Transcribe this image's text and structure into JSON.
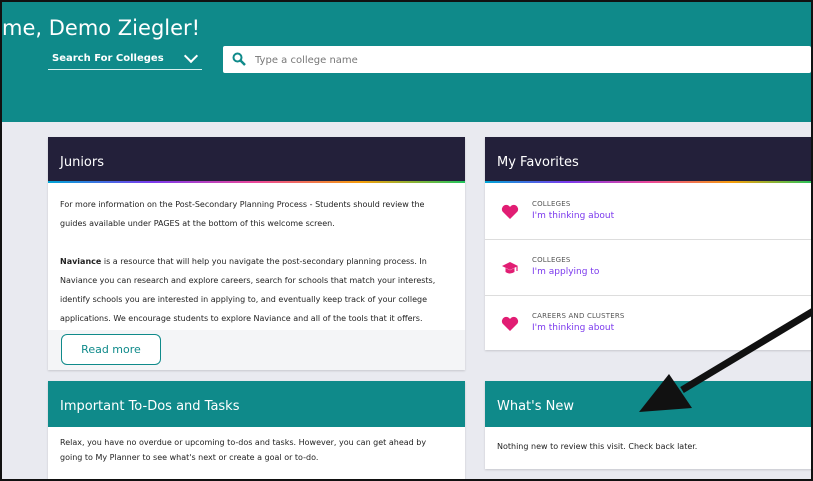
{
  "header": {
    "welcome": "me, Demo Ziegler!",
    "search_select": "Search For Colleges",
    "search_placeholder": "Type a college name"
  },
  "juniors": {
    "title": "Juniors",
    "line1": "For more information on the Post-Secondary Planning Process - Students should review the guides available under PAGES at the bottom of this welcome screen.",
    "brand": "Naviance",
    "line2": " is a resource that will help you navigate the post-secondary planning process. In Naviance you can research and explore careers, search for schools that match your interests, identify schools you are interested in applying to, and eventually keep track of your college applications. We encourage students to explore Naviance and all of the tools that it offers.",
    "button": "Read more"
  },
  "favorites": {
    "title": "My Favorites",
    "items": [
      {
        "category": "COLLEGES",
        "link": "I'm thinking about",
        "icon": "heart-icon"
      },
      {
        "category": "COLLEGES",
        "link": "I'm applying to",
        "icon": "graduation-cap-icon"
      },
      {
        "category": "CAREERS AND CLUSTERS",
        "link": "I'm thinking about",
        "icon": "heart-icon"
      }
    ]
  },
  "todos": {
    "title": "Important To-Dos and Tasks",
    "text": "Relax, you have no overdue or upcoming to-dos and tasks. However, you can get ahead by going to My Planner to see what's next or create a goal or to-do."
  },
  "whats_new": {
    "title": "What's New",
    "text": "Nothing new to review this visit. Check back later."
  },
  "colors": {
    "teal": "#0f8a8a",
    "dark": "#23203a",
    "accent": "#7c3aed",
    "heart": "#e11d73"
  }
}
